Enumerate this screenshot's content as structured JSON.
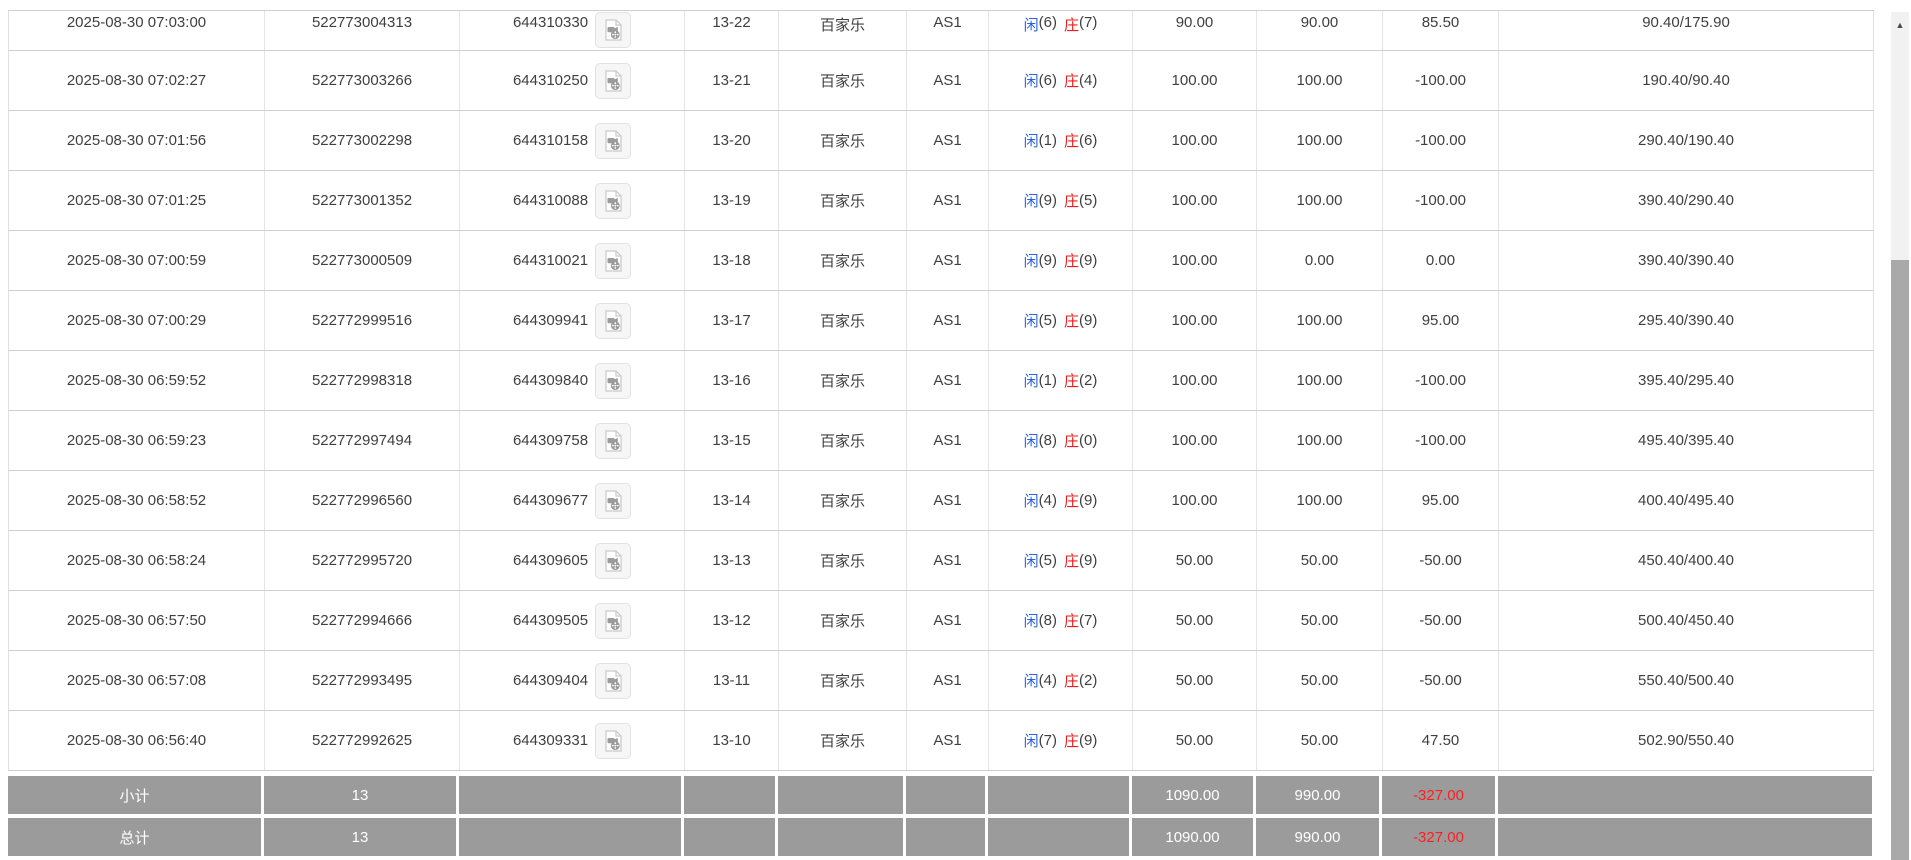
{
  "colors": {
    "player_blue": "#2a62e0",
    "bet_link_blue": "#2a6cd8",
    "loss_red": "#f21c1c",
    "footer_gray": "#9b9b9b",
    "footer_loss_red": "#ff1f1f"
  },
  "icons": {
    "round_video": "video-replay-icon",
    "scroll_up_glyph": "▲"
  },
  "table": {
    "rows": [
      {
        "time": "2025-08-30 07:03:00",
        "bet_id": "522773004313",
        "round_id": "644310330",
        "round_no": "13-22",
        "game": "百家乐",
        "table_name": "AS1",
        "player_label": "闲",
        "player_score": "(6)",
        "banker_label": "庄",
        "banker_score": "(7)",
        "bet": "90.00",
        "valid": "90.00",
        "winloss": "85.50",
        "balance": "90.40/175.90"
      },
      {
        "time": "2025-08-30 07:02:27",
        "bet_id": "522773003266",
        "round_id": "644310250",
        "round_no": "13-21",
        "game": "百家乐",
        "table_name": "AS1",
        "player_label": "闲",
        "player_score": "(6)",
        "banker_label": "庄",
        "banker_score": "(4)",
        "bet": "100.00",
        "valid": "100.00",
        "winloss": "-100.00",
        "balance": "190.40/90.40"
      },
      {
        "time": "2025-08-30 07:01:56",
        "bet_id": "522773002298",
        "round_id": "644310158",
        "round_no": "13-20",
        "game": "百家乐",
        "table_name": "AS1",
        "player_label": "闲",
        "player_score": "(1)",
        "banker_label": "庄",
        "banker_score": "(6)",
        "bet": "100.00",
        "valid": "100.00",
        "winloss": "-100.00",
        "balance": "290.40/190.40"
      },
      {
        "time": "2025-08-30 07:01:25",
        "bet_id": "522773001352",
        "round_id": "644310088",
        "round_no": "13-19",
        "game": "百家乐",
        "table_name": "AS1",
        "player_label": "闲",
        "player_score": "(9)",
        "banker_label": "庄",
        "banker_score": "(5)",
        "bet": "100.00",
        "valid": "100.00",
        "winloss": "-100.00",
        "balance": "390.40/290.40"
      },
      {
        "time": "2025-08-30 07:00:59",
        "bet_id": "522773000509",
        "round_id": "644310021",
        "round_no": "13-18",
        "game": "百家乐",
        "table_name": "AS1",
        "player_label": "闲",
        "player_score": "(9)",
        "banker_label": "庄",
        "banker_score": "(9)",
        "bet": "100.00",
        "valid": "0.00",
        "winloss": "0.00",
        "balance": "390.40/390.40"
      },
      {
        "time": "2025-08-30 07:00:29",
        "bet_id": "522772999516",
        "round_id": "644309941",
        "round_no": "13-17",
        "game": "百家乐",
        "table_name": "AS1",
        "player_label": "闲",
        "player_score": "(5)",
        "banker_label": "庄",
        "banker_score": "(9)",
        "bet": "100.00",
        "valid": "100.00",
        "winloss": "95.00",
        "balance": "295.40/390.40"
      },
      {
        "time": "2025-08-30 06:59:52",
        "bet_id": "522772998318",
        "round_id": "644309840",
        "round_no": "13-16",
        "game": "百家乐",
        "table_name": "AS1",
        "player_label": "闲",
        "player_score": "(1)",
        "banker_label": "庄",
        "banker_score": "(2)",
        "bet": "100.00",
        "valid": "100.00",
        "winloss": "-100.00",
        "balance": "395.40/295.40"
      },
      {
        "time": "2025-08-30 06:59:23",
        "bet_id": "522772997494",
        "round_id": "644309758",
        "round_no": "13-15",
        "game": "百家乐",
        "table_name": "AS1",
        "player_label": "闲",
        "player_score": "(8)",
        "banker_label": "庄",
        "banker_score": "(0)",
        "bet": "100.00",
        "valid": "100.00",
        "winloss": "-100.00",
        "balance": "495.40/395.40"
      },
      {
        "time": "2025-08-30 06:58:52",
        "bet_id": "522772996560",
        "round_id": "644309677",
        "round_no": "13-14",
        "game": "百家乐",
        "table_name": "AS1",
        "player_label": "闲",
        "player_score": "(4)",
        "banker_label": "庄",
        "banker_score": "(9)",
        "bet": "100.00",
        "valid": "100.00",
        "winloss": "95.00",
        "balance": "400.40/495.40"
      },
      {
        "time": "2025-08-30 06:58:24",
        "bet_id": "522772995720",
        "round_id": "644309605",
        "round_no": "13-13",
        "game": "百家乐",
        "table_name": "AS1",
        "player_label": "闲",
        "player_score": "(5)",
        "banker_label": "庄",
        "banker_score": "(9)",
        "bet": "50.00",
        "valid": "50.00",
        "winloss": "-50.00",
        "balance": "450.40/400.40"
      },
      {
        "time": "2025-08-30 06:57:50",
        "bet_id": "522772994666",
        "round_id": "644309505",
        "round_no": "13-12",
        "game": "百家乐",
        "table_name": "AS1",
        "player_label": "闲",
        "player_score": "(8)",
        "banker_label": "庄",
        "banker_score": "(7)",
        "bet": "50.00",
        "valid": "50.00",
        "winloss": "-50.00",
        "balance": "500.40/450.40"
      },
      {
        "time": "2025-08-30 06:57:08",
        "bet_id": "522772993495",
        "round_id": "644309404",
        "round_no": "13-11",
        "game": "百家乐",
        "table_name": "AS1",
        "player_label": "闲",
        "player_score": "(4)",
        "banker_label": "庄",
        "banker_score": "(2)",
        "bet": "50.00",
        "valid": "50.00",
        "winloss": "-50.00",
        "balance": "550.40/500.40"
      },
      {
        "time": "2025-08-30 06:56:40",
        "bet_id": "522772992625",
        "round_id": "644309331",
        "round_no": "13-10",
        "game": "百家乐",
        "table_name": "AS1",
        "player_label": "闲",
        "player_score": "(7)",
        "banker_label": "庄",
        "banker_score": "(9)",
        "bet": "50.00",
        "valid": "50.00",
        "winloss": "47.50",
        "balance": "502.90/550.40"
      }
    ],
    "footer": [
      {
        "label": "小计",
        "count": "13",
        "bet": "1090.00",
        "valid": "990.00",
        "winloss": "-327.00"
      },
      {
        "label": "总计",
        "count": "13",
        "bet": "1090.00",
        "valid": "990.00",
        "winloss": "-327.00"
      }
    ]
  }
}
